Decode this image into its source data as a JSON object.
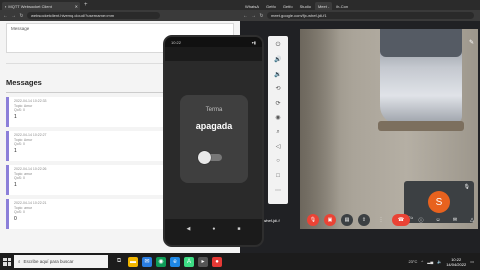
{
  "left_browser": {
    "tab_title": "MQTT Websocket Client",
    "url": "websocketclient.hivemq.cloud/?username=mm",
    "message_label": "Message",
    "messages_title": "Messages",
    "messages": [
      {
        "time": "2022-04-14 10:22:33",
        "meta1": "Topic: Amur",
        "meta2": "QoS: 0",
        "value": "1"
      },
      {
        "time": "2022-04-14 10:22:27",
        "meta1": "Topic: Amur",
        "meta2": "QoS: 0",
        "value": "1"
      },
      {
        "time": "2022-04-14 10:22:26",
        "meta1": "Topic: amur",
        "meta2": "QoS: 0",
        "value": "1"
      },
      {
        "time": "2022-04-14 10:22:21",
        "meta1": "Topic: amur",
        "meta2": "QoS: 0",
        "value": "0"
      }
    ]
  },
  "right_browser": {
    "tabs": [
      "WhatsA",
      "Getfo",
      "Getfo",
      "Studio",
      "Meet -",
      "ih-Con"
    ],
    "url": "meet.google.com/fjx-whef-jdi-f1",
    "caption": "fjx-whef-jdi-f",
    "self_name": "Tú",
    "avatar_letter": "S"
  },
  "phone": {
    "status_time": "10:22",
    "card_title": "Terma",
    "state": "apagada"
  },
  "taskbar": {
    "search_placeholder": "Escribe aquí para buscar",
    "temperature": "23°C",
    "time": "10:22",
    "date": "14/04/2022"
  },
  "colors": {
    "accent_message": "#8b7fd9",
    "meet_red": "#ea4335",
    "avatar": "#e8621e"
  }
}
